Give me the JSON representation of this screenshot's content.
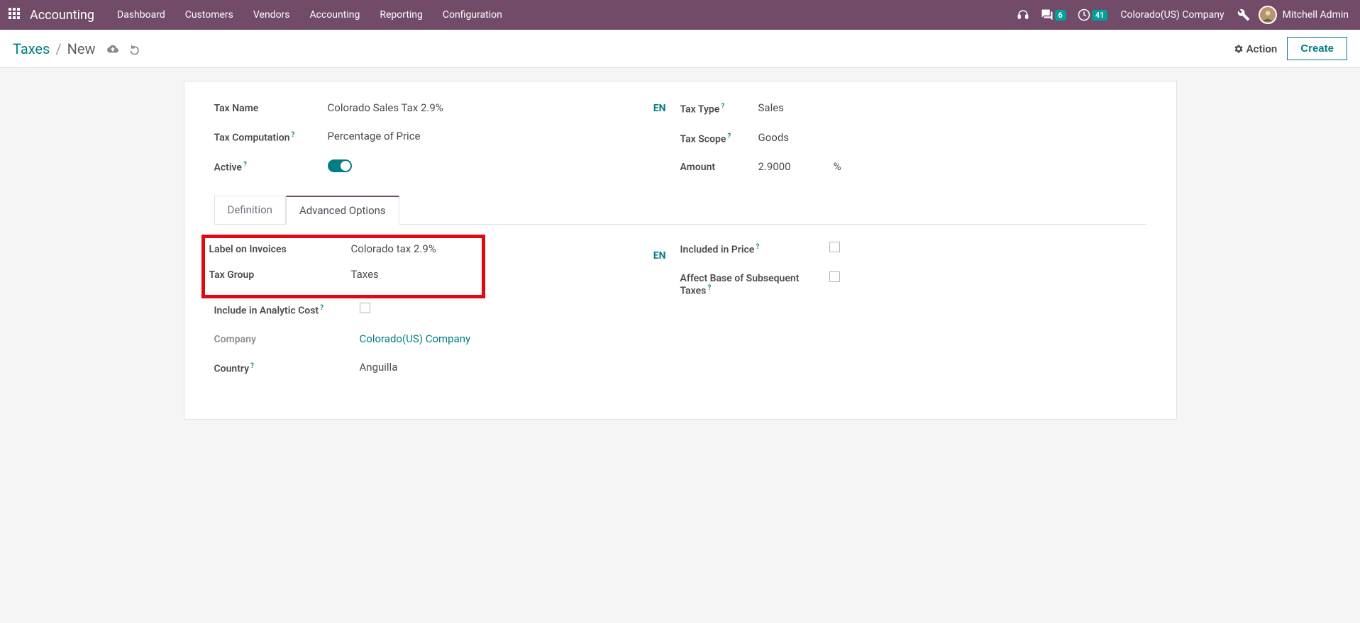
{
  "topbar": {
    "app_title": "Accounting",
    "nav": [
      "Dashboard",
      "Customers",
      "Vendors",
      "Accounting",
      "Reporting",
      "Configuration"
    ],
    "messages_count": "6",
    "activities_count": "41",
    "company": "Colorado(US) Company",
    "user_name": "Mitchell Admin"
  },
  "subheader": {
    "breadcrumb_root": "Taxes",
    "breadcrumb_sep": "/",
    "breadcrumb_current": "New",
    "action_label": "Action",
    "create_label": "Create"
  },
  "form": {
    "tax_name_label": "Tax Name",
    "tax_name_value": "Colorado Sales Tax 2.9%",
    "lang": "EN",
    "tax_computation_label": "Tax Computation",
    "tax_computation_value": "Percentage of Price",
    "active_label": "Active",
    "tax_type_label": "Tax Type",
    "tax_type_value": "Sales",
    "tax_scope_label": "Tax Scope",
    "tax_scope_value": "Goods",
    "amount_label": "Amount",
    "amount_value": "2.9000",
    "amount_unit": "%",
    "help": "?"
  },
  "tabs": {
    "definition": "Definition",
    "advanced": "Advanced Options"
  },
  "advanced": {
    "label_invoices_label": "Label on Invoices",
    "label_invoices_value": "Colorado tax 2.9%",
    "lang": "EN",
    "tax_group_label": "Tax Group",
    "tax_group_value": "Taxes",
    "include_analytic_label": "Include in Analytic Cost",
    "company_label": "Company",
    "company_value": "Colorado(US) Company",
    "country_label": "Country",
    "country_value": "Anguilla",
    "included_price_label": "Included in Price",
    "affect_base_label": "Affect Base of Subsequent Taxes"
  }
}
